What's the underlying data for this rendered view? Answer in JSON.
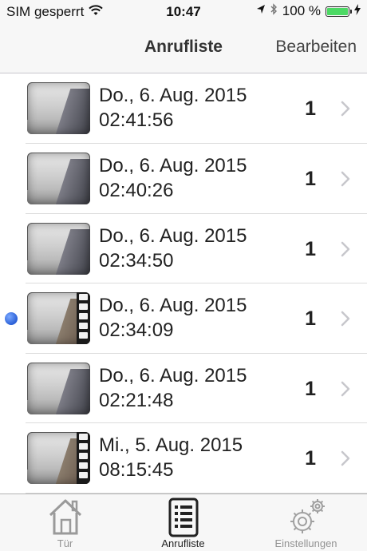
{
  "status_bar": {
    "carrier": "SIM gesperrt",
    "time": "10:47",
    "battery": "100 %",
    "battery_level": 1.0,
    "battery_color": "#4cd964"
  },
  "nav": {
    "title": "Anrufliste",
    "edit_label": "Bearbeiten"
  },
  "calls": [
    {
      "date": "Do., 6. Aug. 2015",
      "time": "02:41:56",
      "count": "1",
      "unread": false,
      "video": false
    },
    {
      "date": "Do., 6. Aug. 2015",
      "time": "02:40:26",
      "count": "1",
      "unread": false,
      "video": false
    },
    {
      "date": "Do., 6. Aug. 2015",
      "time": "02:34:50",
      "count": "1",
      "unread": false,
      "video": false
    },
    {
      "date": "Do., 6. Aug. 2015",
      "time": "02:34:09",
      "count": "1",
      "unread": true,
      "video": true
    },
    {
      "date": "Do., 6. Aug. 2015",
      "time": "02:21:48",
      "count": "1",
      "unread": false,
      "video": false
    },
    {
      "date": "Mi., 5. Aug. 2015",
      "time": "08:15:45",
      "count": "1",
      "unread": false,
      "video": true
    }
  ],
  "tabs": [
    {
      "label": "Tür",
      "icon": "house-icon",
      "active": false
    },
    {
      "label": "Anrufliste",
      "icon": "call-list-icon",
      "active": true
    },
    {
      "label": "Einstellungen",
      "icon": "gears-icon",
      "active": false
    }
  ],
  "colors": {
    "unread_dot": "#2a5fd6",
    "bar_background": "#f7f7f7",
    "tab_inactive": "#929292"
  }
}
